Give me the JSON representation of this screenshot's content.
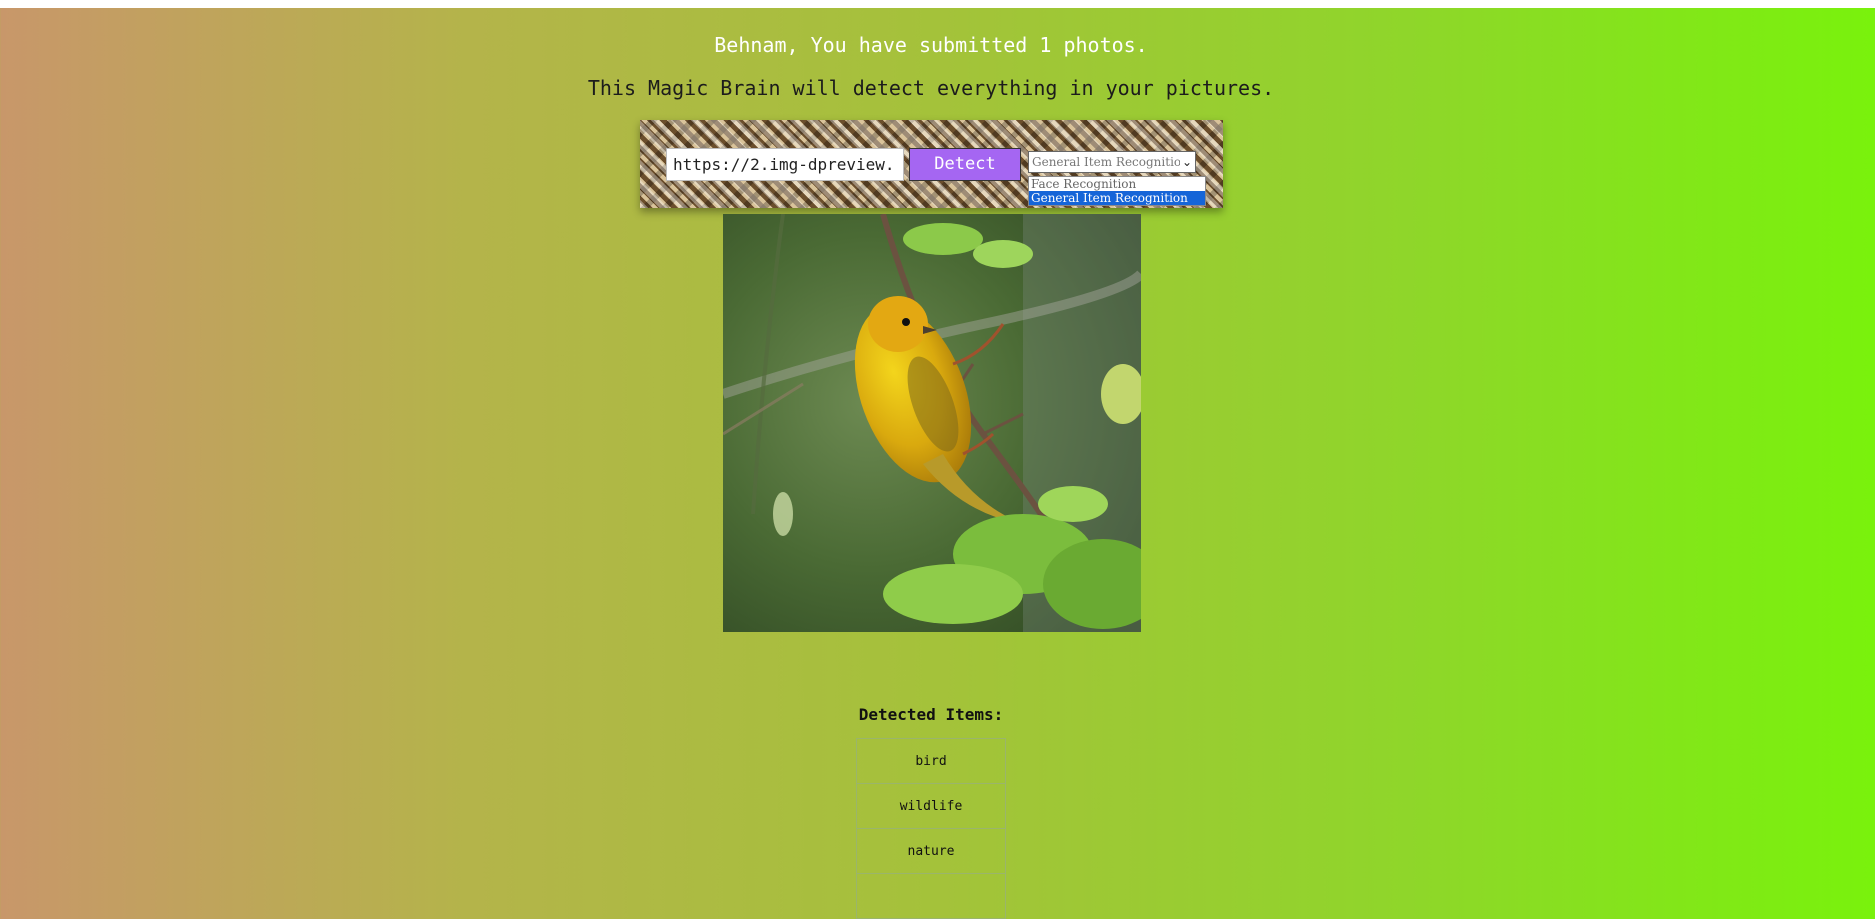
{
  "header": {
    "greeting": "Behnam, You have submitted 1 photos.",
    "subtitle": "This Magic Brain will detect everything in your pictures."
  },
  "form": {
    "url_value": "https://2.img-dpreview.",
    "detect_label": "Detect",
    "select": {
      "current": "General Item Recognition",
      "options": [
        "Face Recognition",
        "General Item Recognition"
      ],
      "selected_index": 1
    }
  },
  "image": {
    "subject_icon": "photo-of-yellow-bird-on-branch"
  },
  "results": {
    "title": "Detected Items:",
    "items": [
      "bird",
      "wildlife",
      "nature"
    ]
  },
  "colors": {
    "detect_button": "#a566f2",
    "selected_option": "#1565d8"
  }
}
